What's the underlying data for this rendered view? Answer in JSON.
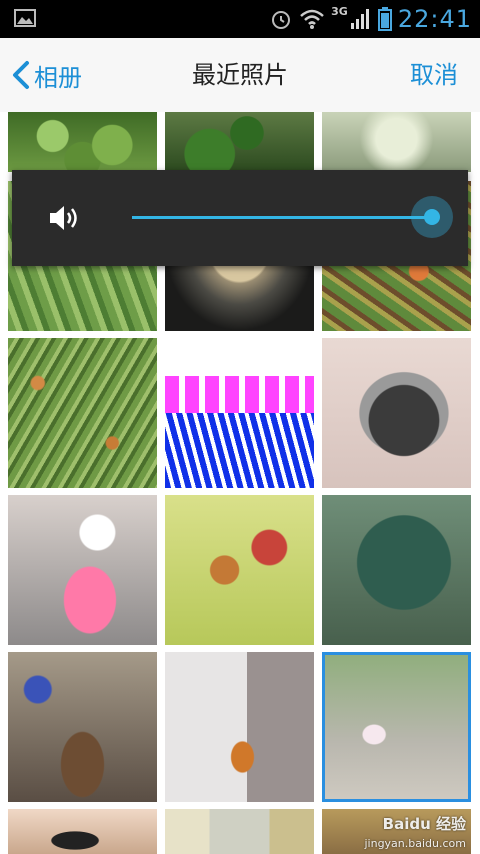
{
  "status_bar": {
    "network_label": "3G",
    "time": "22:41",
    "icons": [
      "picture-icon",
      "alarm-icon",
      "wifi-icon",
      "signal-icon",
      "battery-icon"
    ]
  },
  "header": {
    "back_label": "相册",
    "title": "最近照片",
    "cancel_label": "取消",
    "accent_color": "#1c8fd6"
  },
  "volume_overlay": {
    "icon": "speaker-icon",
    "level_fraction": 1.0,
    "accent_color": "#33b5e5"
  },
  "photos": [
    {
      "name": "broccoli-1"
    },
    {
      "name": "broccoli-2"
    },
    {
      "name": "cabbage"
    },
    {
      "name": "vegetables-1"
    },
    {
      "name": "pot"
    },
    {
      "name": "stir-fry"
    },
    {
      "name": "green-beans"
    },
    {
      "name": "pattern"
    },
    {
      "name": "handbag"
    },
    {
      "name": "snowman-decor"
    },
    {
      "name": "gift-display"
    },
    {
      "name": "christmas-tree"
    },
    {
      "name": "dinner-table"
    },
    {
      "name": "girl-in-orange"
    },
    {
      "name": "girl-in-park",
      "selected": true
    },
    {
      "name": "face-plush"
    },
    {
      "name": "cup"
    },
    {
      "name": "room"
    }
  ],
  "watermark": {
    "main": "Baidu 经验",
    "sub": "jingyan.baidu.com"
  }
}
